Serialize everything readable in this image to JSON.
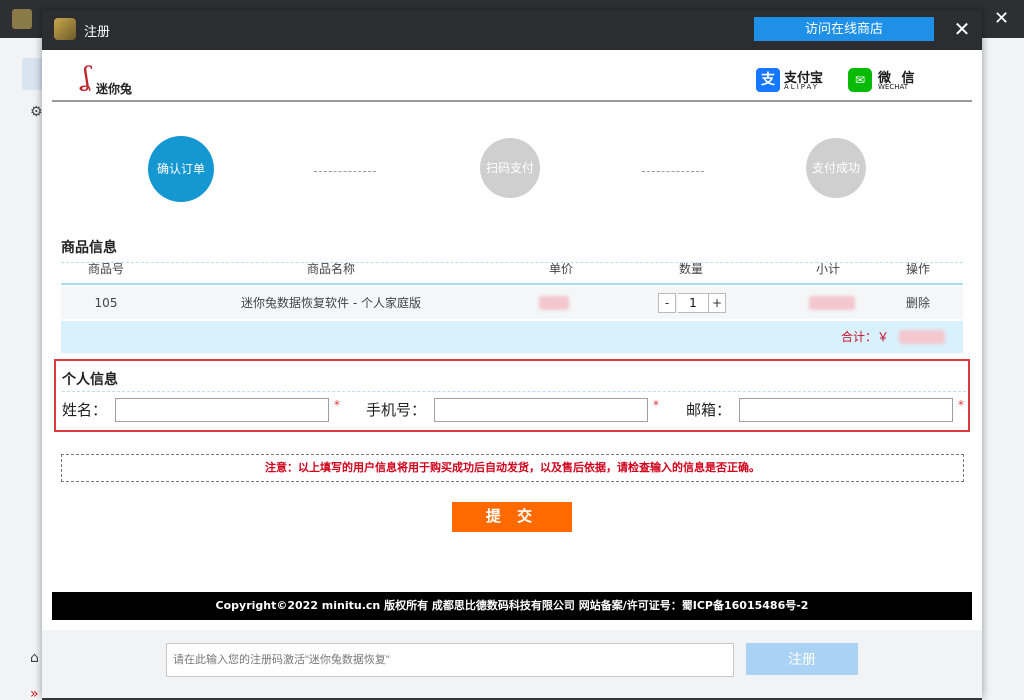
{
  "modal": {
    "title": "注册",
    "store_button": "访问在线商店",
    "close_symbol": "✕"
  },
  "header": {
    "logo_text": "迷你兔",
    "alipay": {
      "name": "支付宝",
      "sub": "ALIPAY"
    },
    "wechat": {
      "name": "微 信",
      "sub": "WECHAT"
    }
  },
  "steps": [
    {
      "label": "确认订单"
    },
    {
      "label": "扫码支付"
    },
    {
      "label": "支付成功"
    }
  ],
  "product": {
    "section_title": "商品信息",
    "columns": [
      "商品号",
      "商品名称",
      "单价",
      "数量",
      "小计",
      "操作"
    ],
    "row": {
      "id": "105",
      "name": "迷你兔数据恢复软件 - 个人家庭版",
      "quantity": "1",
      "action": "删除",
      "minus": "-",
      "plus": "+"
    },
    "total_label": "合计：￥"
  },
  "personal": {
    "section_title": "个人信息",
    "name_label": "姓名：",
    "phone_label": "手机号：",
    "email_label": "邮箱：",
    "required_mark": "*"
  },
  "notice": "注意：以上填写的用户信息将用于购买成功后自动发货，以及售后依据，请检查输入的信息是否正确。",
  "submit_label": "提 交",
  "copyright": "Copyright©2022 minitu.cn 版权所有 成都思比德数码科技有限公司 网站备案/许可证号：蜀ICP备16015486号-2",
  "bottom": {
    "code_placeholder": "请在此输入您的注册码激活\"迷你兔数据恢复\"",
    "register_label": "注册"
  },
  "colors": {
    "accent": "#1597d2",
    "submit": "#ff6a00",
    "required": "#e0393e",
    "notice": "#d0021b"
  }
}
